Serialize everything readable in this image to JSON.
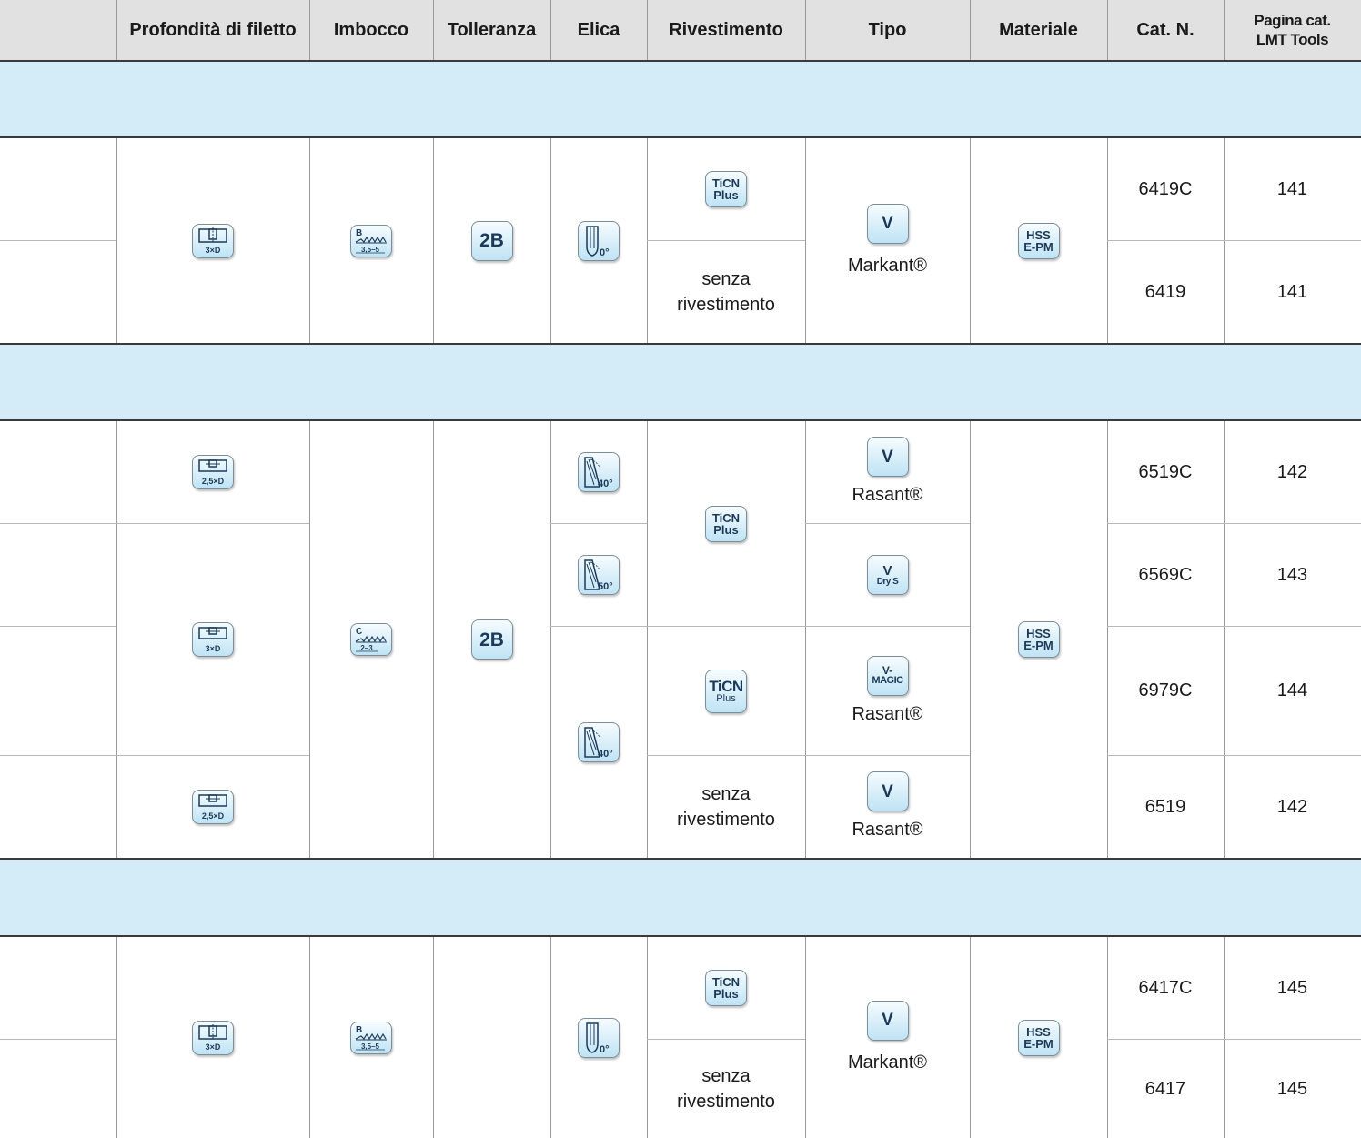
{
  "header": {
    "col_blank": "",
    "depth": "Profondità di filetto",
    "entry": "Imbocco",
    "tolerance": "Tolleranza",
    "helix": "Elica",
    "coating": "Rivestimento",
    "type": "Tipo",
    "material": "Materiale",
    "cat_no": "Cat. N.",
    "page_line1": "Pagina cat.",
    "page_line2": "LMT Tools"
  },
  "badges": {
    "depth_3xd": "3×D",
    "depth_25xd": "2,5×D",
    "entry_b_letter": "B",
    "entry_b_range": "3,5–5",
    "entry_c_letter": "C",
    "entry_c_range": "2–3",
    "tolerance_2b": "2B",
    "helix_0": "0°",
    "helix_40": "40°",
    "helix_50": "50°",
    "ticn_l1": "TiCN",
    "ticn_l2": "Plus",
    "v": "V",
    "v_dry_l1": "V",
    "v_dry_l2": "Dry S",
    "v_magic_l1": "V-",
    "v_magic_l2": "MAGIC",
    "hss_l1": "HSS",
    "hss_l2": "E-PM"
  },
  "labels": {
    "uncoated_l1": "senza",
    "uncoated_l2": "rivestimento",
    "markant": "Markant®",
    "rasant": "Rasant®"
  },
  "groups": [
    {
      "rows": [
        {
          "cat_no": "6419C",
          "page": "141"
        },
        {
          "cat_no": "6419",
          "page": "141"
        }
      ]
    },
    {
      "rows": [
        {
          "cat_no": "6519C",
          "page": "142"
        },
        {
          "cat_no": "6569C",
          "page": "143"
        },
        {
          "cat_no": "6979C",
          "page": "144"
        },
        {
          "cat_no": "6519",
          "page": "142"
        }
      ]
    },
    {
      "rows": [
        {
          "cat_no": "6417C",
          "page": "145"
        },
        {
          "cat_no": "6417",
          "page": "145"
        }
      ]
    }
  ],
  "colors": {
    "header_bg": "#e1e1e1",
    "band_bg": "#d3ecf8",
    "badge_text": "#1b3a5a"
  }
}
